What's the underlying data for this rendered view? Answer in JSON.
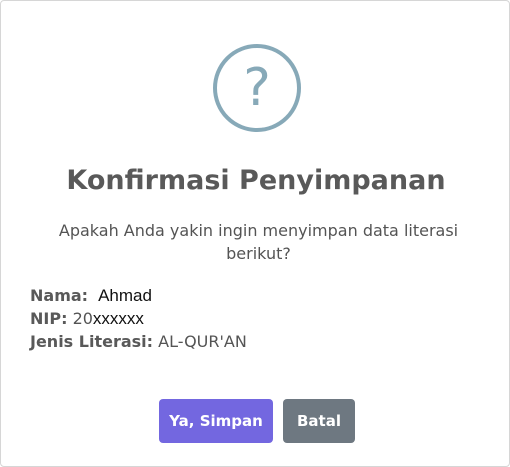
{
  "dialog": {
    "icon": "question-mark-icon",
    "icon_glyph": "?",
    "title": "Konfirmasi Penyimpanan",
    "message": "Apakah Anda yakin ingin menyimpan data literasi berikut?",
    "fields": {
      "nama_label": "Nama:",
      "nama_value": "Ahmad",
      "nip_label": "NIP:",
      "nip_prefix": "20",
      "nip_masked": "xxxxxx",
      "literasi_label": "Jenis Literasi:",
      "literasi_value": "AL-QUR'AN"
    },
    "confirm_label": "Ya, Simpan",
    "cancel_label": "Batal"
  },
  "colors": {
    "confirm": "#7367e0",
    "cancel": "#6e7881",
    "icon": "#87a9b8"
  }
}
